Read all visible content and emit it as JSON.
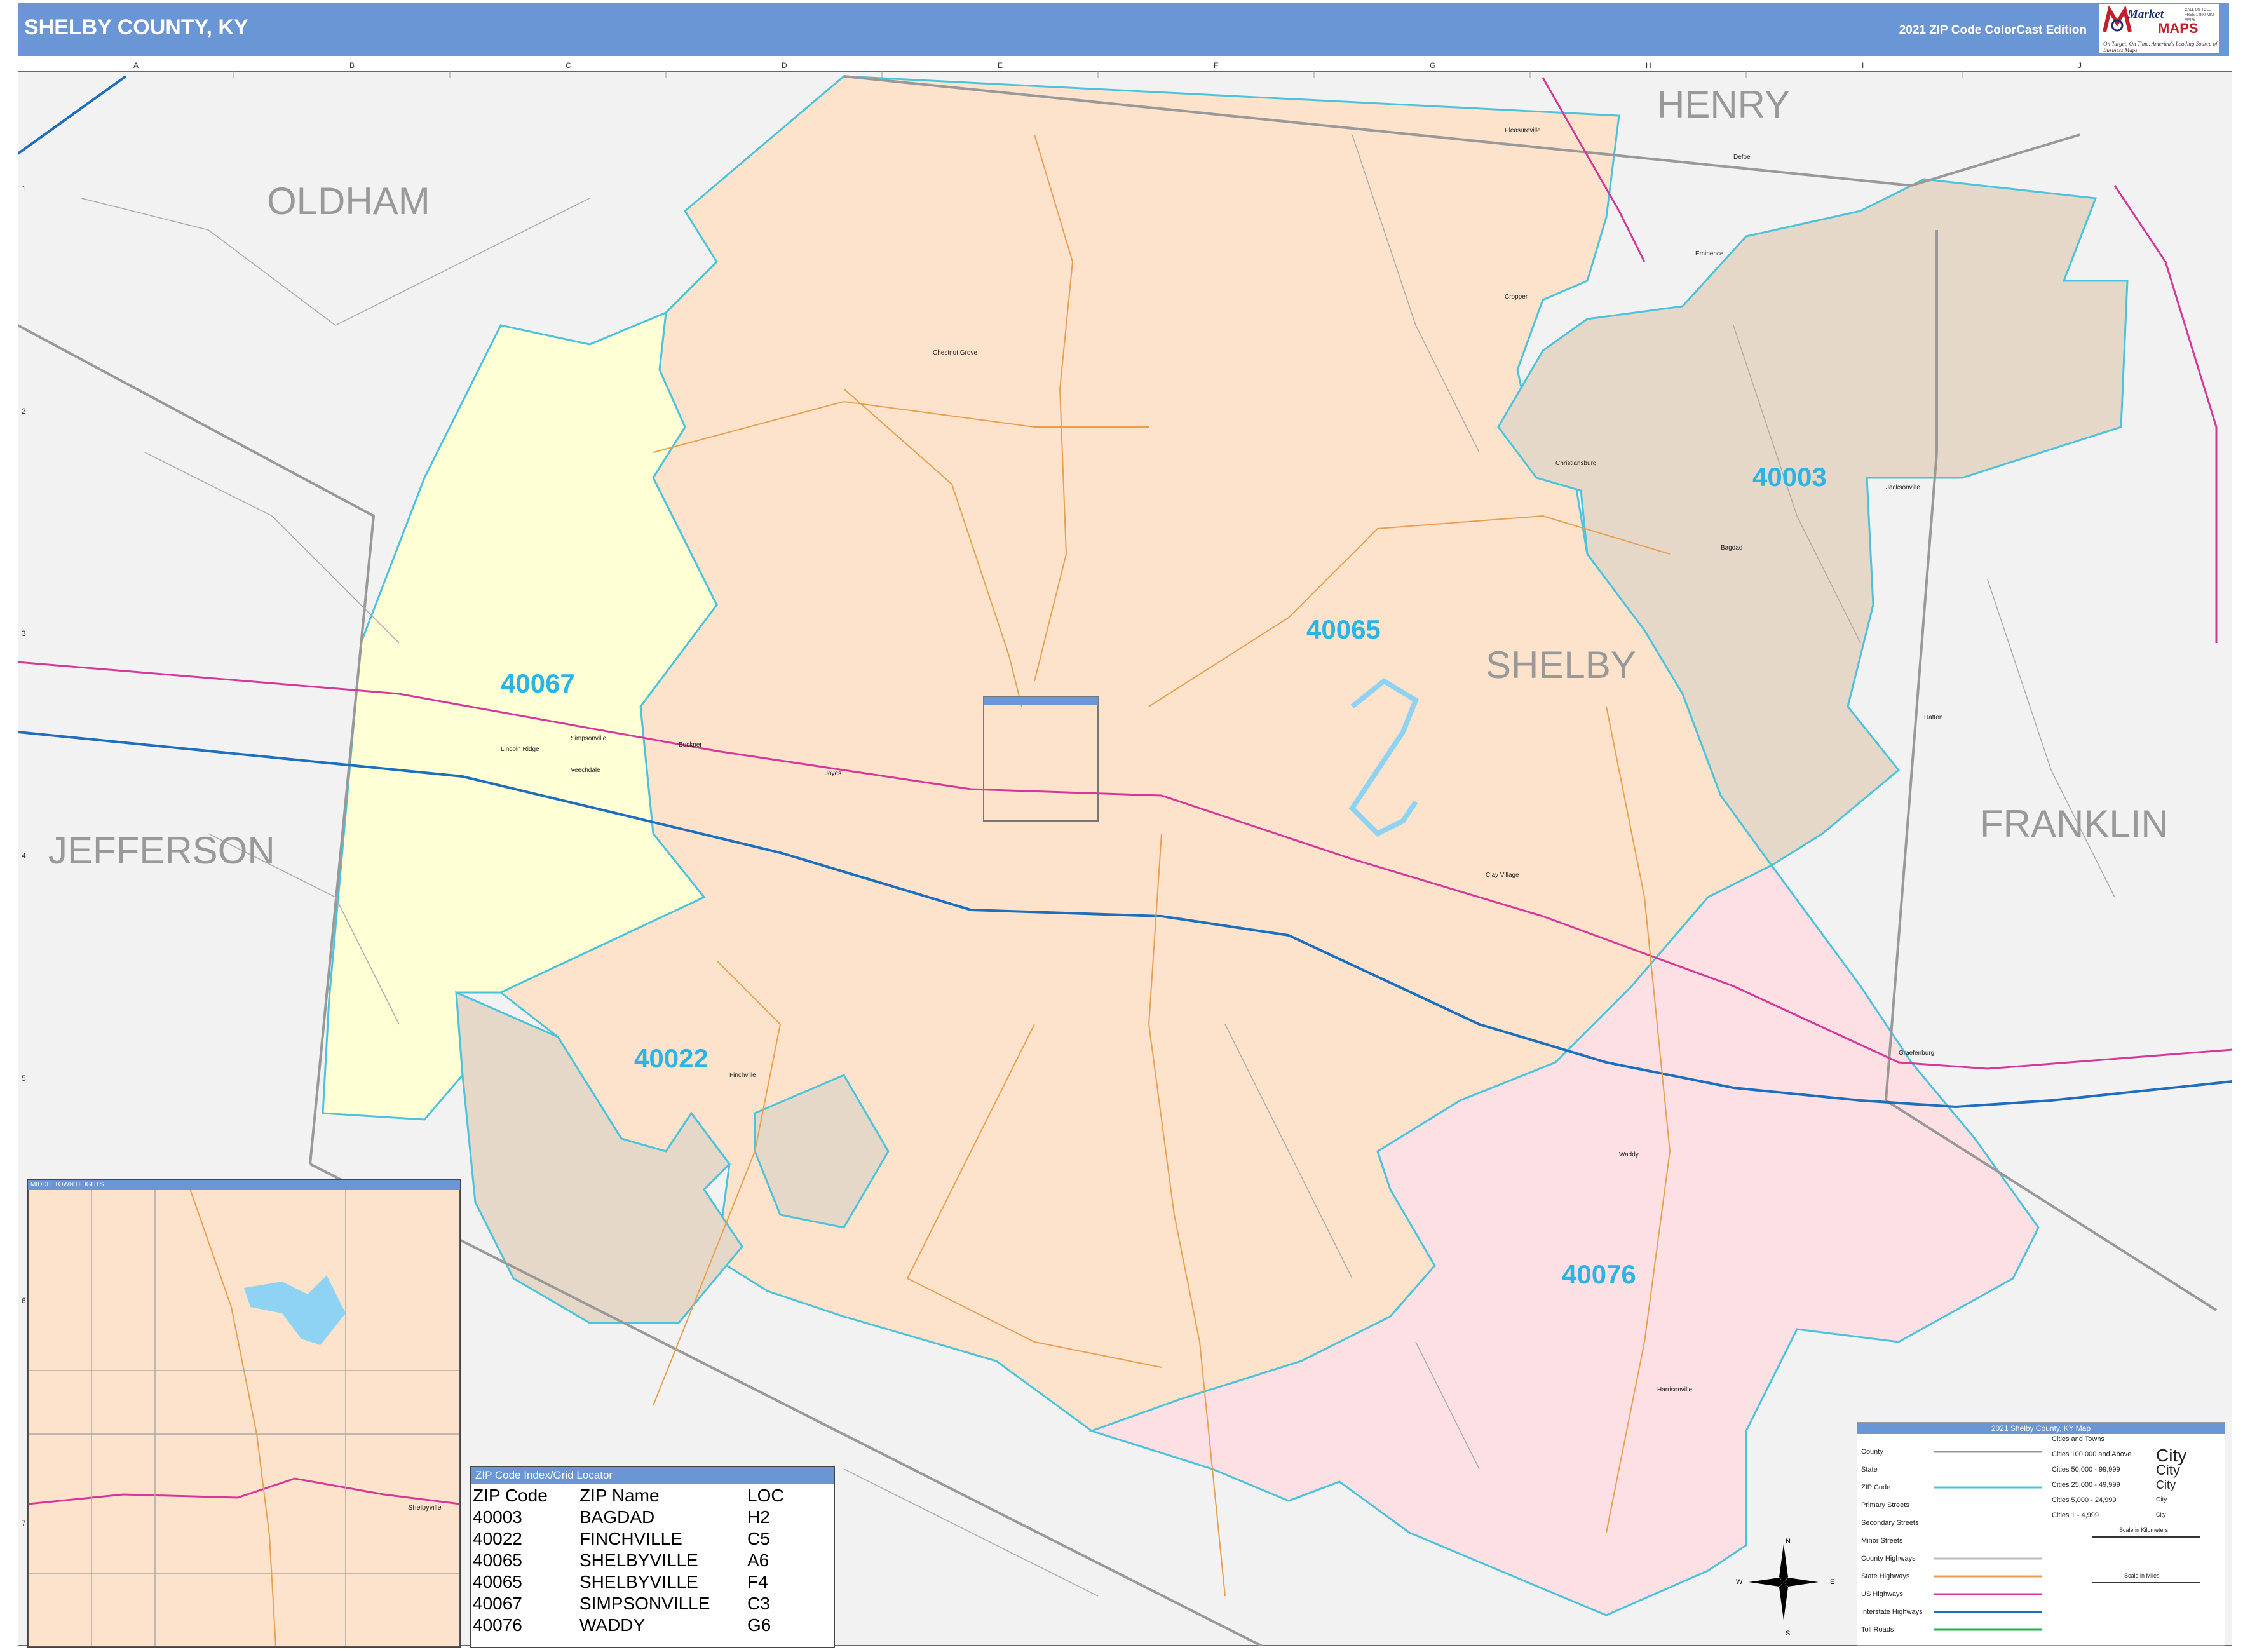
{
  "header": {
    "title": "SHELBY COUNTY, KY",
    "edition": "2021 ZIP Code ColorCast Edition"
  },
  "logo": {
    "brand_top": "Market",
    "brand_bottom": "MAPS",
    "tagline": "On Target, On Time. America's Leading Source of Business Maps",
    "contact": "CALL US TOLL FREE 1-800-MKT-MAPS"
  },
  "counties": {
    "oldham": "OLDHAM",
    "henry": "HENRY",
    "jefferson": "JEFFERSON",
    "franklin": "FRANKLIN",
    "shelby": "SHELBY"
  },
  "zip_labels": {
    "z40003": "40003",
    "z40022": "40022",
    "z40065": "40065",
    "z40067": "40067",
    "z40076": "40076"
  },
  "places": {
    "pleasureville": "Pleasureville",
    "defoe": "Defoe",
    "eminence": "Eminence",
    "cropper": "Cropper",
    "chestnut_grove": "Chestnut Grove",
    "christiansburg": "Christiansburg",
    "jacksonville": "Jacksonville",
    "bagdad": "Bagdad",
    "simpsonville": "Simpsonville",
    "lincoln_ridge": "Lincoln Ridge",
    "veechdale": "Veechdale",
    "buckner": "Buckner",
    "joyes": "Joyes",
    "clay_village": "Clay Village",
    "hatton": "Hatton",
    "graefenburg": "Graefenburg",
    "finchville": "Finchville",
    "waddy": "Waddy",
    "harrisonville": "Harrisonville",
    "shelbyville": "Shelbyville"
  },
  "grid": {
    "columns": [
      "A",
      "B",
      "C",
      "D",
      "E",
      "F",
      "G",
      "H",
      "I",
      "J"
    ],
    "rows": [
      "1",
      "2",
      "3",
      "4",
      "5",
      "6",
      "7"
    ]
  },
  "inset": {
    "title": "MIDDLETOWN HEIGHTS",
    "map_label": "MIDDLETOWN HEIGHTS"
  },
  "index": {
    "title": "ZIP Code Index/Grid Locator",
    "headers": [
      "ZIP Code",
      "ZIP Name",
      "LOC"
    ],
    "rows": [
      [
        "40003",
        "BAGDAD",
        "H2"
      ],
      [
        "40022",
        "FINCHVILLE",
        "C5"
      ],
      [
        "40065",
        "SHELBYVILLE",
        "A6"
      ],
      [
        "40065",
        "SHELBYVILLE",
        "F4"
      ],
      [
        "40067",
        "SIMPSONVILLE",
        "C3"
      ],
      [
        "40076",
        "WADDY",
        "G6"
      ]
    ]
  },
  "legend": {
    "title": "2021 Shelby County, KY Map",
    "cities_header": "Cities and Towns",
    "items": [
      "County",
      "State",
      "ZIP Code",
      "Primary Streets",
      "Secondary Streets",
      "Minor Streets",
      "County Highways",
      "State Highways",
      "US Highways",
      "Interstate Highways",
      "Toll Roads"
    ],
    "city_sizes": [
      "Cities 100,000 and Above",
      "Cities 50,000 - 99,999",
      "Cities 25,000 - 49,999",
      "Cities 5,000 - 24,999",
      "Cities 1 - 4,999"
    ],
    "city_samples": [
      "City",
      "City",
      "City",
      "City",
      "City"
    ],
    "scale_km": "Scale in Kilometers",
    "scale_mi": "Scale in Miles"
  },
  "compass": {
    "n": "N",
    "s": "S",
    "e": "E",
    "w": "W"
  },
  "colors": {
    "header": "#6b96d6",
    "zip_40065": "#fde3cc",
    "zip_40067": "#ffffd6",
    "zip_40022": "#e6d8c8",
    "zip_40003": "#e6d8c8",
    "zip_40076": "#fde0e4",
    "outside": "#f2f2f2",
    "zip_border": "#4cc3dc",
    "zip_text": "#2bb4e4",
    "county_text": "#999999",
    "us_highway": "#d6389a",
    "interstate": "#1d6fbe"
  }
}
